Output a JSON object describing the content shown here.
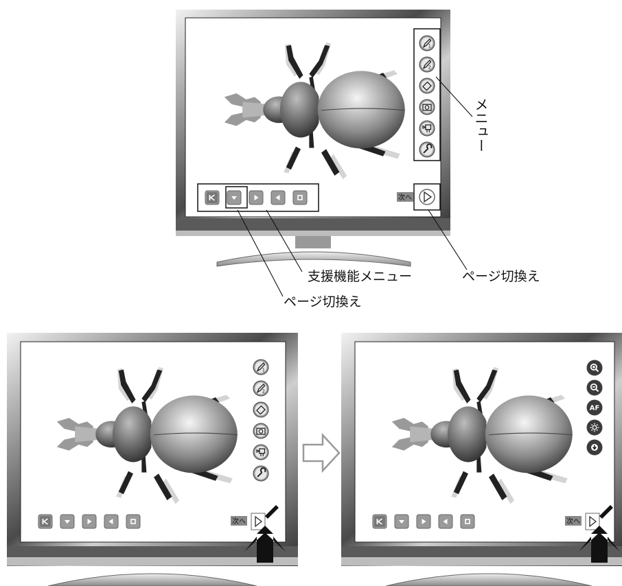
{
  "callouts": {
    "menu": "メニュー",
    "assist_menu": "支援機能メニュー",
    "page_switch_right": "ページ切換え",
    "page_switch_left": "ページ切換え"
  },
  "screen": {
    "next_label": "次へ"
  },
  "screen_after": {
    "af_label": "AF"
  },
  "icons": {
    "menu_before": [
      "pen-1-icon",
      "pen-2-icon",
      "eraser-icon",
      "camera-icon",
      "projector-icon",
      "wrench-icon"
    ],
    "menu_after": [
      "zoom-in-icon",
      "zoom-out-icon",
      "af-icon",
      "brightness-icon",
      "down-icon"
    ],
    "assist": [
      "first-page-icon",
      "triangle-down-icon",
      "triangle-right-icon",
      "triangle-left-icon",
      "stop-square-icon"
    ],
    "transition": "transition-arrow-icon",
    "press": "press-up-arrow-icon",
    "stylus": "stylus-pen-icon"
  },
  "colors": {
    "button_fill": "#9a9a9a",
    "button_dark": "#555555",
    "monitor_dark": "#333333",
    "monitor_light": "#d9d9d9",
    "arrow_outline": "#999999"
  }
}
